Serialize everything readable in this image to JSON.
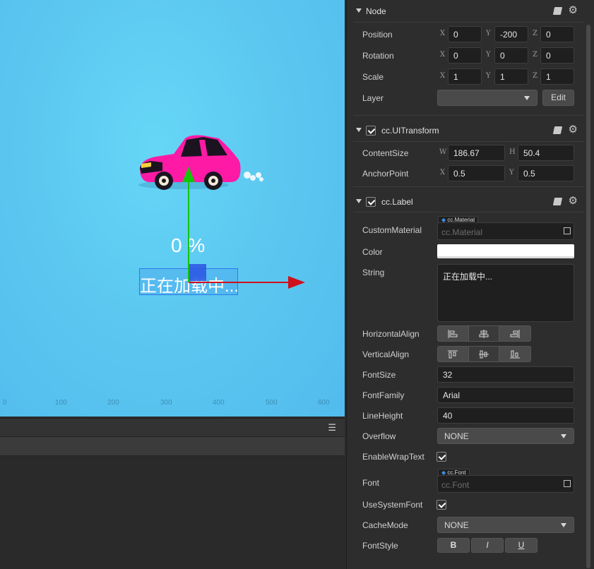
{
  "scene": {
    "percent_text": "0 %",
    "label_text": "正在加载中...",
    "ruler_ticks": [
      "0",
      "100",
      "200",
      "300",
      "400",
      "500",
      "600"
    ]
  },
  "bottom_panel": {
    "menu_icon": "☰"
  },
  "node_section": {
    "title": "Node",
    "position": {
      "label": "Position",
      "x": "0",
      "y": "-200",
      "z": "0"
    },
    "rotation": {
      "label": "Rotation",
      "x": "0",
      "y": "0",
      "z": "0"
    },
    "scale": {
      "label": "Scale",
      "x": "1",
      "y": "1",
      "z": "1"
    },
    "layer": {
      "label": "Layer",
      "value": "",
      "edit_label": "Edit"
    }
  },
  "ui_transform": {
    "title": "cc.UITransform",
    "content_size": {
      "label": "ContentSize",
      "w_axis": "W",
      "h_axis": "H",
      "w": "186.67",
      "h": "50.4"
    },
    "anchor_point": {
      "label": "AnchorPoint",
      "x": "0.5",
      "y": "0.5"
    }
  },
  "label_component": {
    "title": "cc.Label",
    "custom_material": {
      "label": "CustomMaterial",
      "tag": "cc.Material",
      "placeholder": "cc.Material"
    },
    "color": {
      "label": "Color",
      "value": "#ffffff"
    },
    "string": {
      "label": "String",
      "value": "正在加载中..."
    },
    "horizontal_align": {
      "label": "HorizontalAlign",
      "options": [
        "left",
        "center",
        "right"
      ],
      "selected": "center"
    },
    "vertical_align": {
      "label": "VerticalAlign",
      "options": [
        "top",
        "center",
        "bottom"
      ],
      "selected": "center"
    },
    "font_size": {
      "label": "FontSize",
      "value": "32"
    },
    "font_family": {
      "label": "FontFamily",
      "value": "Arial"
    },
    "line_height": {
      "label": "LineHeight",
      "value": "40"
    },
    "overflow": {
      "label": "Overflow",
      "value": "NONE"
    },
    "enable_wrap_text": {
      "label": "EnableWrapText",
      "checked": true
    },
    "font": {
      "label": "Font",
      "tag": "cc.Font",
      "placeholder": "cc.Font"
    },
    "use_system_font": {
      "label": "UseSystemFont",
      "checked": true
    },
    "cache_mode": {
      "label": "CacheMode",
      "value": "NONE"
    },
    "font_style": {
      "label": "FontStyle",
      "bold": "B",
      "italic": "I",
      "underline": "U"
    }
  },
  "colors": {
    "scene_bg": "#5cc8f0",
    "gizmo_x": "#d0101a",
    "gizmo_y": "#14c40a",
    "selection": "#2f79e8",
    "car_body": "#ff1aa6"
  }
}
